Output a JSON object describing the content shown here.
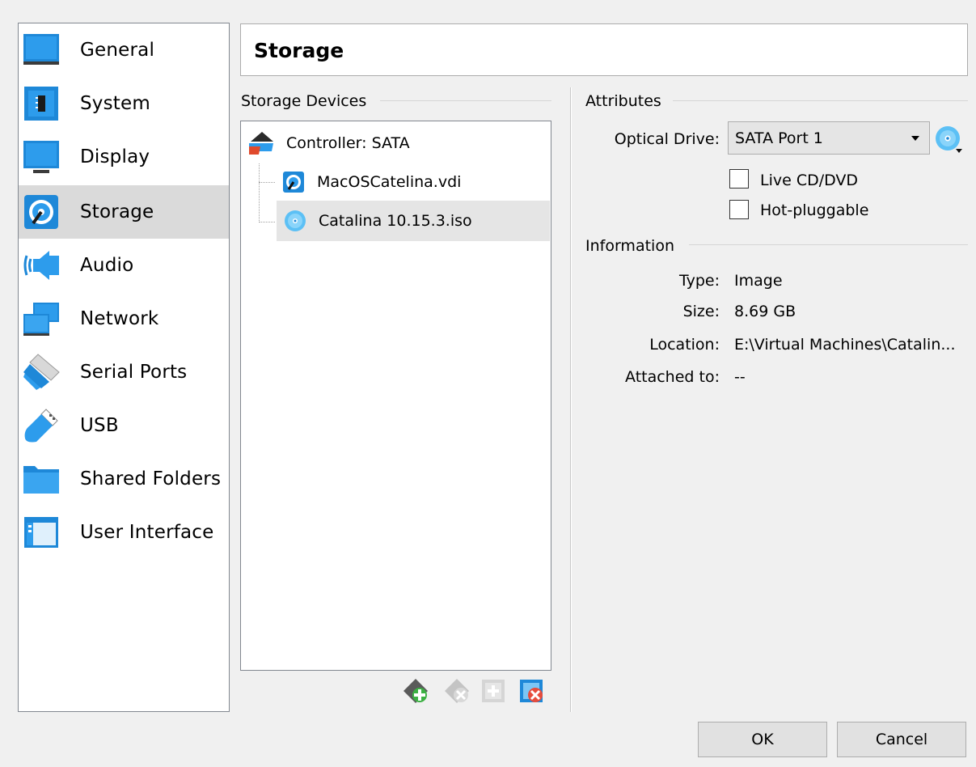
{
  "sidebar": {
    "items": [
      {
        "label": "General",
        "icon": "general-monitor-icon"
      },
      {
        "label": "System",
        "icon": "system-chip-icon"
      },
      {
        "label": "Display",
        "icon": "display-monitor-icon"
      },
      {
        "label": "Storage",
        "icon": "storage-disk-icon",
        "selected": true
      },
      {
        "label": "Audio",
        "icon": "audio-speaker-icon"
      },
      {
        "label": "Network",
        "icon": "network-monitors-icon"
      },
      {
        "label": "Serial Ports",
        "icon": "serial-port-icon"
      },
      {
        "label": "USB",
        "icon": "usb-plug-icon"
      },
      {
        "label": "Shared Folders",
        "icon": "folder-icon"
      },
      {
        "label": "User Interface",
        "icon": "window-layout-icon"
      }
    ]
  },
  "header": {
    "title": "Storage"
  },
  "storage_devices": {
    "group_title": "Storage Devices",
    "controller": "Controller: SATA",
    "attachments": [
      {
        "name": "MacOSCatelina.vdi",
        "icon": "hard-disk-icon"
      },
      {
        "name": "Catalina 10.15.3.iso",
        "icon": "optical-disc-icon",
        "selected": true
      }
    ],
    "toolbar": [
      "add-controller-icon",
      "remove-controller-icon",
      "add-attachment-icon",
      "remove-attachment-icon"
    ]
  },
  "attributes": {
    "group_title": "Attributes",
    "optical_drive_label": "Optical Drive:",
    "optical_drive_value": "SATA Port 1",
    "live_cd_label": "Live CD/DVD",
    "live_cd_checked": false,
    "hot_pluggable_label": "Hot-pluggable",
    "hot_pluggable_checked": false
  },
  "information": {
    "group_title": "Information",
    "type_label": "Type:",
    "type_value": "Image",
    "size_label": "Size:",
    "size_value": "8.69 GB",
    "location_label": "Location:",
    "location_value": "E:\\Virtual Machines\\Catalin...",
    "attached_label": "Attached to:",
    "attached_value": "--"
  },
  "buttons": {
    "ok": "OK",
    "cancel": "Cancel"
  },
  "colors": {
    "accent_blue": "#1e8fe0",
    "selection_gray": "#dadada"
  }
}
